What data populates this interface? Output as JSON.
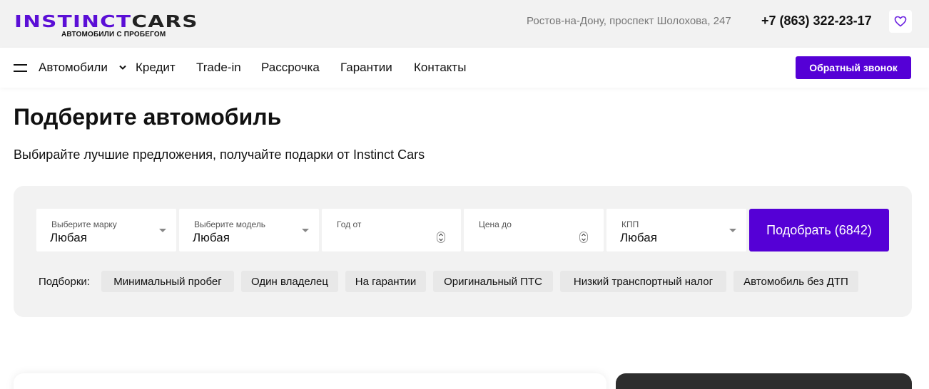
{
  "header": {
    "logo_text_a": "INSTINCT",
    "logo_text_b": "CARS",
    "logo_subtitle": "АВТОМОБИЛИ С ПРОБЕГОМ",
    "address": "Ростов-на-Дону, проспект Шолохова, 247",
    "phone": "+7 (863) 322-23-17",
    "favorites_icon": "heart-icon"
  },
  "nav": {
    "menu_icon": "hamburger-icon",
    "items": [
      {
        "label": "Автомобили"
      },
      {
        "label": "Кредит"
      },
      {
        "label": "Trade-in"
      },
      {
        "label": "Рассрочка"
      },
      {
        "label": "Гарантии"
      },
      {
        "label": "Контакты"
      }
    ],
    "callback_label": "Обратный звонок"
  },
  "main": {
    "title": "Подберите автомобиль",
    "subtitle": "Выбирайте лучшие предложения, получайте подарки от Instinct Cars"
  },
  "filter": {
    "fields": [
      {
        "label": "Выберите марку",
        "value": "Любая"
      },
      {
        "label": "Выберите модель",
        "value": "Любая"
      },
      {
        "label": "Год от",
        "value": ""
      },
      {
        "label": "Цена до",
        "value": ""
      },
      {
        "label": "КПП",
        "value": "Любая"
      }
    ],
    "submit_label": "Подобрать (6842)",
    "selections_label": "Подборки:",
    "chips": [
      {
        "label": "Минимальный пробег"
      },
      {
        "label": "Один владелец"
      },
      {
        "label": "На гарантии"
      },
      {
        "label": "Оригинальный ПТС"
      },
      {
        "label": "Низкий транспортный налог"
      },
      {
        "label": "Автомобиль без ДТП"
      }
    ]
  },
  "colors": {
    "brand": "#5500d6",
    "panel": "#f2f2f2",
    "chip": "#e8e8e8"
  }
}
